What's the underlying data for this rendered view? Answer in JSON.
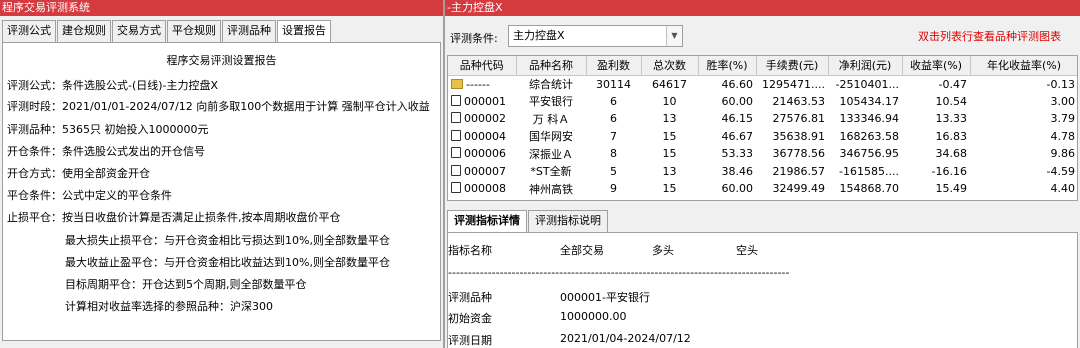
{
  "left": {
    "title": "程序交易评测系统",
    "tabs": [
      "评测公式",
      "建仓规则",
      "交易方式",
      "平仓规则",
      "评测品种",
      "设置报告"
    ],
    "active_tab": 5,
    "report": {
      "heading": "程序交易评测设置报告",
      "lines": [
        "评测公式：条件选股公式-(日线)-主力控盘X",
        "评测时段：2021/01/01-2024/07/12 向前多取100个数据用于计算 强制平仓计入收益",
        "评测品种：5365只 初始投入1000000元",
        "开仓条件：条件选股公式发出的开仓信号",
        "开仓方式：使用全部资金开仓",
        "平仓条件：公式中定义的平仓条件",
        "止损平仓：按当日收盘价计算是否满足止损条件,按本周期收盘价平仓",
        "最大损失止损平仓：与开仓资金相比亏损达到10%,则全部数量平仓",
        "最大收益止盈平仓：与开仓资金相比收益达到10%,则全部数量平仓",
        "目标周期平仓：开仓达到5个周期,则全部数量平仓",
        "计算相对收益率选择的参照品种：沪深300"
      ]
    }
  },
  "right": {
    "title": "-主力控盘X",
    "condition_label": "评测条件:",
    "condition_value": "主力控盘X",
    "hint": "双击列表行查看品种评测图表",
    "columns": [
      "品种代码",
      "品种名称",
      "盈利数",
      "总次数",
      "胜率(%)",
      "手续费(元)",
      "净利润(元)",
      "收益率(%)",
      "年化收益率(%)"
    ],
    "rows": [
      [
        "------",
        "综合统计",
        "30114",
        "64617",
        "46.60",
        "1295471....",
        "-2510401...",
        "-0.47",
        "-0.13"
      ],
      [
        "000001",
        "平安银行",
        "6",
        "10",
        "60.00",
        "21463.53",
        "105434.17",
        "10.54",
        "3.00"
      ],
      [
        "000002",
        "万 科Ａ",
        "6",
        "13",
        "46.15",
        "27576.81",
        "133346.94",
        "13.33",
        "3.79"
      ],
      [
        "000004",
        "国华网安",
        "7",
        "15",
        "46.67",
        "35638.91",
        "168263.58",
        "16.83",
        "4.78"
      ],
      [
        "000006",
        "深振业Ａ",
        "8",
        "15",
        "53.33",
        "36778.56",
        "346756.95",
        "34.68",
        "9.86"
      ],
      [
        "000007",
        "*ST全新",
        "5",
        "13",
        "38.46",
        "21986.57",
        "-161585....",
        "-16.16",
        "-4.59"
      ],
      [
        "000008",
        "神州高铁",
        "9",
        "15",
        "60.00",
        "32499.49",
        "154868.70",
        "15.49",
        "4.40"
      ]
    ],
    "detail_tabs": [
      "评测指标详情",
      "评测指标说明"
    ],
    "detail_header": [
      "指标名称",
      "全部交易",
      "多头",
      "空头"
    ],
    "separator": "--------------------------------------------------------------------------------------",
    "detail_rows": [
      {
        "label": "评测品种",
        "value": "000001-平安银行"
      },
      {
        "label": "初始资金",
        "value": "1000000.00"
      },
      {
        "label": "评测日期",
        "value": "2021/01/04-2024/07/12"
      }
    ]
  }
}
